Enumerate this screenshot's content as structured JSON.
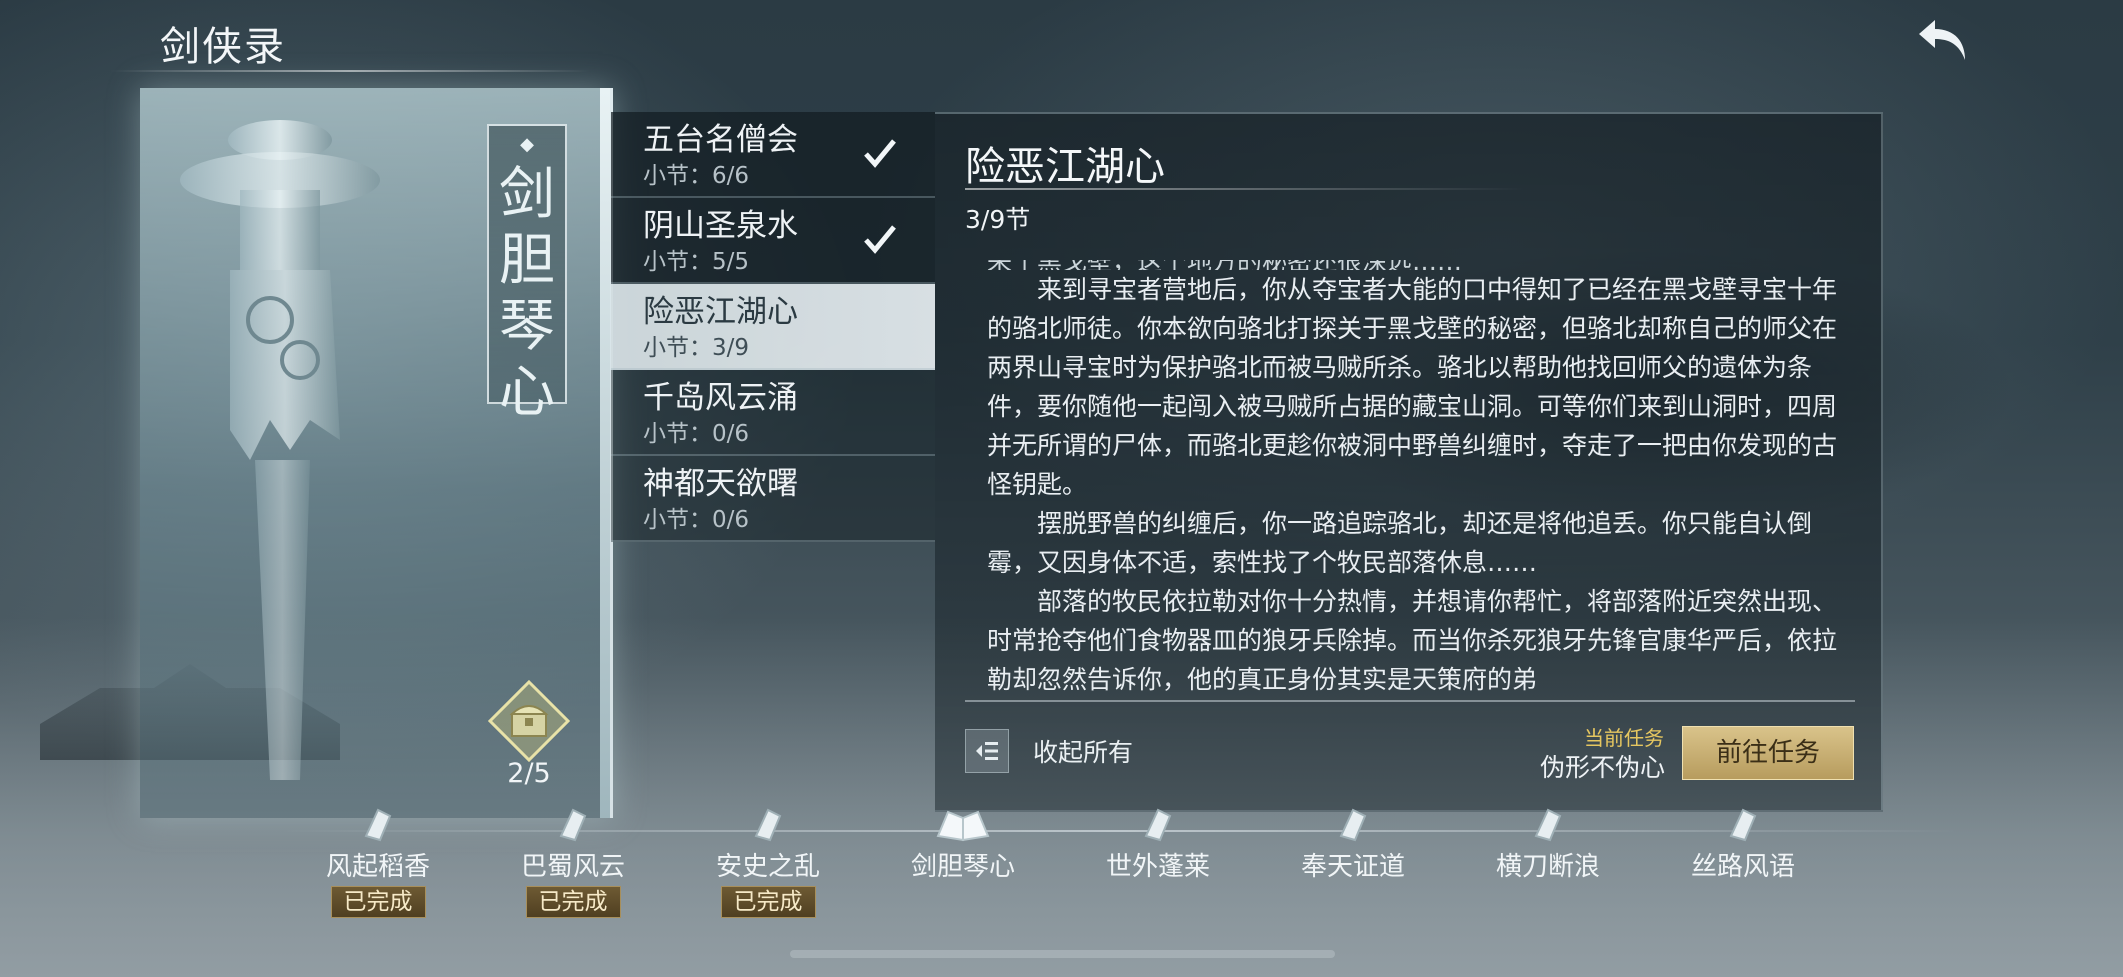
{
  "header": {
    "title": "剑侠录",
    "back_icon": "back-arrow-icon"
  },
  "book": {
    "title_chars": [
      "剑",
      "胆",
      "琴",
      "心"
    ],
    "chest_icon": "treasure-chest-icon",
    "chest_progress": "2/5"
  },
  "chapters": [
    {
      "name": "五台名僧会",
      "sub": "小节：6/6",
      "done": true
    },
    {
      "name": "阴山圣泉水",
      "sub": "小节：5/5",
      "done": true
    },
    {
      "name": "险恶江湖心",
      "sub": "小节：3/9",
      "done": false
    },
    {
      "name": "千岛风云涌",
      "sub": "小节：0/6",
      "done": false
    },
    {
      "name": "神都天欲曙",
      "sub": "小节：0/6",
      "done": false
    }
  ],
  "panel": {
    "title": "险恶江湖心",
    "section": "3/9节",
    "paragraphs": [
      "来到寻宝者营地后，你从夺宝者大能的口中得知了已经在黑戈壁寻宝十年的骆北师徒。你本欲向骆北打探关于黑戈壁的秘密，但骆北却称自己的师父在两界山寻宝时为保护骆北而被马贼所杀。骆北以帮助他找回师父的遗体为条件，要你随他一起闯入被马贼所占据的藏宝山洞。可等你们来到山洞时，四周并无所谓的尸体，而骆北更趁你被洞中野兽纠缠时，夺走了一把由你发现的古怪钥匙。",
      "摆脱野兽的纠缠后，你一路追踪骆北，却还是将他追丢。你只能自认倒霉，又因身体不适，索性找了个牧民部落休息……",
      "部落的牧民依拉勒对你十分热情，并想请你帮忙，将部落附近突然出现、时常抢夺他们食物器皿的狼牙兵除掉。而当你杀死狼牙先锋官康华严后，依拉勒却忽然告诉你，他的真正身份其实是天策府的弟"
    ],
    "collapse_label": "收起所有",
    "current_task_label": "当前任务",
    "current_task_value": "伪形不伪心",
    "goto_label": "前往任务"
  },
  "timeline": [
    {
      "name": "风起稻香",
      "badge": "已完成"
    },
    {
      "name": "巴蜀风云",
      "badge": "已完成"
    },
    {
      "name": "安史之乱",
      "badge": "已完成"
    },
    {
      "name": "剑胆琴心",
      "badge": ""
    },
    {
      "name": "世外蓬莱",
      "badge": ""
    },
    {
      "name": "奉天证道",
      "badge": ""
    },
    {
      "name": "横刀断浪",
      "badge": ""
    },
    {
      "name": "丝路风语",
      "badge": ""
    }
  ],
  "colors": {
    "accent_gold": "#e6c760",
    "button_gold": "#d9c38a",
    "badge_brown": "#5e4b29"
  }
}
